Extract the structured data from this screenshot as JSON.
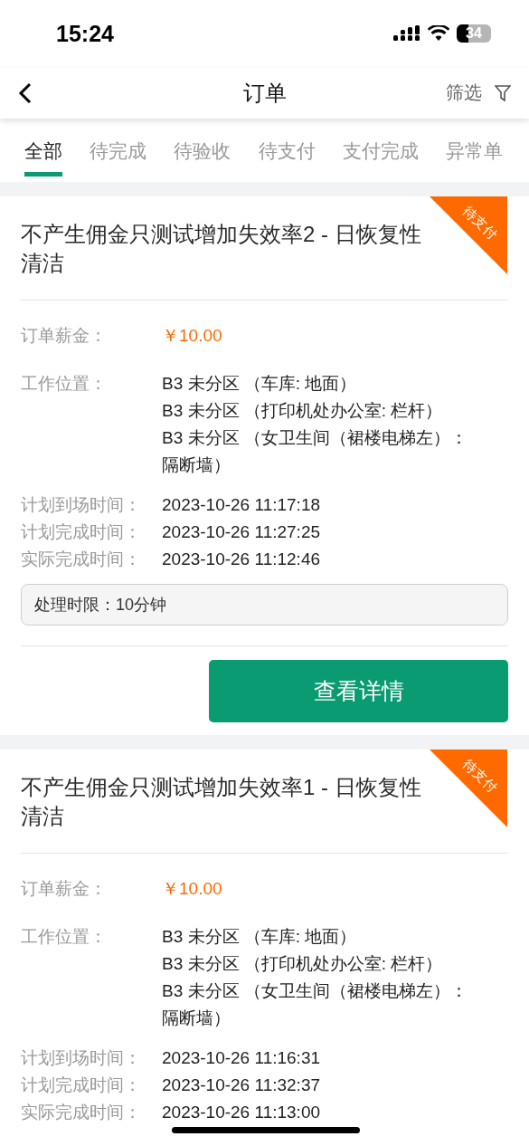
{
  "status_bar": {
    "time": "15:24",
    "battery": "34"
  },
  "nav": {
    "title": "订单",
    "filter": "筛选"
  },
  "tabs": [
    {
      "label": "全部",
      "selected": true
    },
    {
      "label": "待完成",
      "selected": false
    },
    {
      "label": "待验收",
      "selected": false
    },
    {
      "label": "待支付",
      "selected": false
    },
    {
      "label": "支付完成",
      "selected": false
    },
    {
      "label": "异常单",
      "selected": false
    }
  ],
  "orders": [
    {
      "title": "不产生佣金只测试增加失效率2 - 日恢复性清洁",
      "ribbon": "待支付",
      "fields": [
        {
          "kind": "price",
          "label": "订单薪金：",
          "value": "￥10.00"
        },
        {
          "kind": "lines",
          "label": "工作位置：",
          "lines": [
            "B3 未分区 （车库: 地面）",
            "B3 未分区 （打印机处办公室: 栏杆）",
            "B3 未分区 （女卫生间（裙楼电梯左）：隔断墙）"
          ]
        },
        {
          "kind": "time",
          "label": "计划到场时间：",
          "value": "2023-10-26 11:17:18"
        },
        {
          "kind": "time",
          "label": "计划完成时间：",
          "value": "2023-10-26 11:27:25"
        },
        {
          "kind": "time",
          "label": "实际完成时间：",
          "value": "2023-10-26 11:12:46"
        }
      ],
      "time_limit": "处理时限：10分钟",
      "button": "查看详情"
    },
    {
      "title": "不产生佣金只测试增加失效率1 - 日恢复性清洁",
      "ribbon": "待支付",
      "fields": [
        {
          "kind": "price",
          "label": "订单薪金：",
          "value": "￥10.00"
        },
        {
          "kind": "lines",
          "label": "工作位置：",
          "lines": [
            "B3 未分区 （车库: 地面）",
            "B3 未分区 （打印机处办公室: 栏杆）",
            "B3 未分区 （女卫生间（裙楼电梯左）：隔断墙）"
          ]
        },
        {
          "kind": "time",
          "label": "计划到场时间：",
          "value": "2023-10-26 11:16:31"
        },
        {
          "kind": "time",
          "label": "计划完成时间：",
          "value": "2023-10-26 11:32:37"
        },
        {
          "kind": "time",
          "label": "实际完成时间：",
          "value": "2023-10-26 11:13:00"
        }
      ]
    }
  ]
}
